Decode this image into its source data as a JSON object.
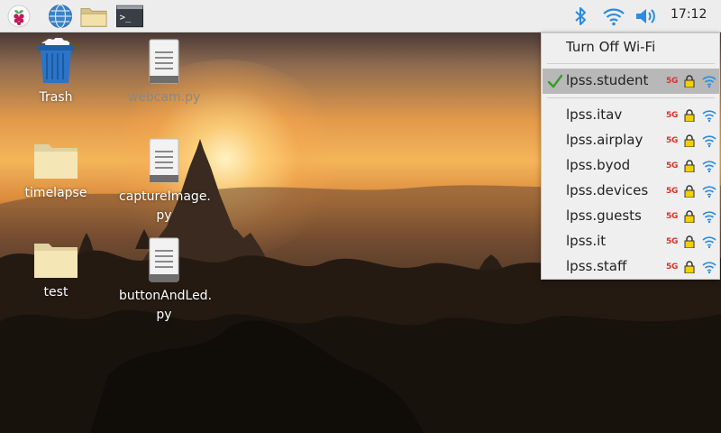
{
  "panel": {
    "clock": "17:12",
    "icons": [
      "raspberry-menu-icon",
      "browser-globe-icon",
      "file-manager-icon",
      "terminal-icon",
      "bluetooth-icon",
      "wifi-icon",
      "volume-icon"
    ]
  },
  "desktop": {
    "icons": [
      {
        "label": "Trash",
        "type": "trash"
      },
      {
        "label": "webcam.py",
        "type": "file"
      },
      {
        "label": "timelapse",
        "type": "folder"
      },
      {
        "label": "captureImage.\npy",
        "type": "file"
      },
      {
        "label": "test",
        "type": "folder"
      },
      {
        "label": "buttonAndLed.\npy",
        "type": "file"
      }
    ]
  },
  "wifi_menu": {
    "turn_off_label": "Turn Off Wi-Fi",
    "connected": {
      "ssid": "lpss.student",
      "band": "5G"
    },
    "networks": [
      {
        "ssid": "lpss.itav",
        "band": "5G"
      },
      {
        "ssid": "lpss.airplay",
        "band": "5G"
      },
      {
        "ssid": "lpss.byod",
        "band": "5G"
      },
      {
        "ssid": "lpss.devices",
        "band": "5G"
      },
      {
        "ssid": "lpss.guests",
        "band": "5G"
      },
      {
        "ssid": "lpss.it",
        "band": "5G"
      },
      {
        "ssid": "lpss.staff",
        "band": "5G"
      }
    ]
  },
  "colors": {
    "panel_bg": "#ededed",
    "menu_bg": "#efefef",
    "selected_bg": "#b8b8b8",
    "accent_blue": "#2a8be0",
    "badge_red": "#e0302a"
  }
}
